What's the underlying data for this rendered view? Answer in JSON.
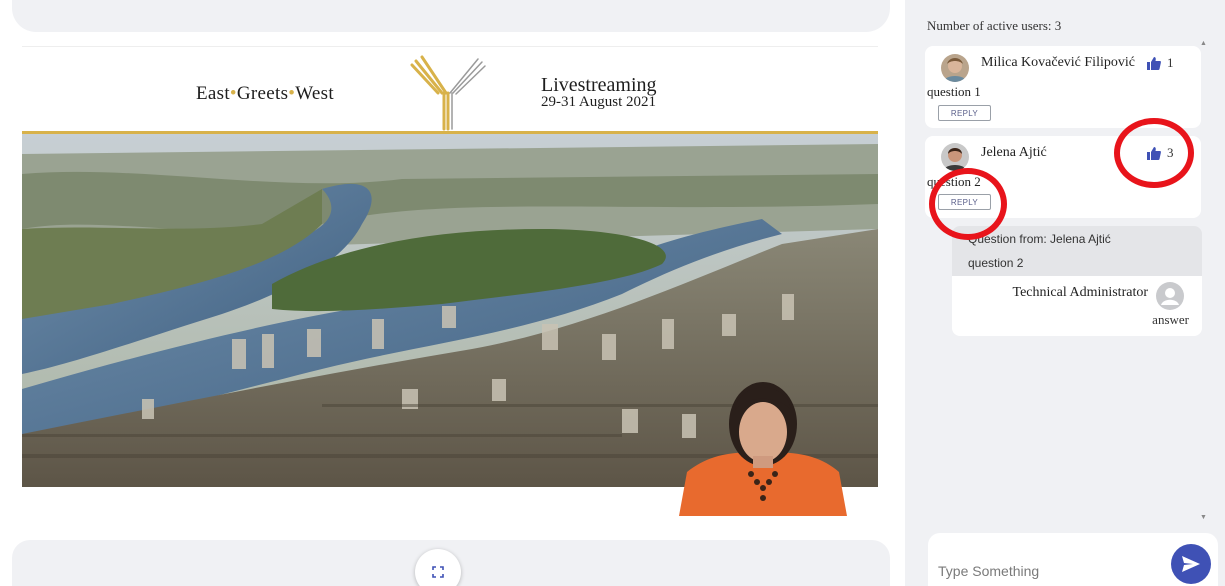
{
  "banner": {
    "left_title": [
      "East",
      "Greets",
      "West"
    ],
    "live_title": "Livestreaming",
    "live_dates": "29-31 August 2021"
  },
  "colors": {
    "gold": "#d8b24a",
    "accent": "#3f51b5",
    "like": "#3f51b5",
    "annotation": "#e8141b",
    "panel_bg": "#f0f1f4"
  },
  "sidebar": {
    "active_users": "Number of active users: 3",
    "questions": [
      {
        "author": "Milica Kovačević Filipović",
        "text": "question 1",
        "likes": "1",
        "reply_label": "REPLY",
        "like_icon": "thumbs-up-icon"
      },
      {
        "author": "Jelena Ajtić",
        "text": "question 2",
        "likes": "3",
        "reply_label": "REPLY",
        "like_icon": "thumbs-up-icon"
      }
    ],
    "thread": {
      "from": "Question from: Jelena Ajtić",
      "question": "question 2",
      "answer_author": "Technical Administrator",
      "answer_text": "answer"
    }
  },
  "chat": {
    "placeholder": "Type Something",
    "send_icon": "send-icon"
  },
  "controls": {
    "fullscreen_icon": "fullscreen-icon"
  }
}
